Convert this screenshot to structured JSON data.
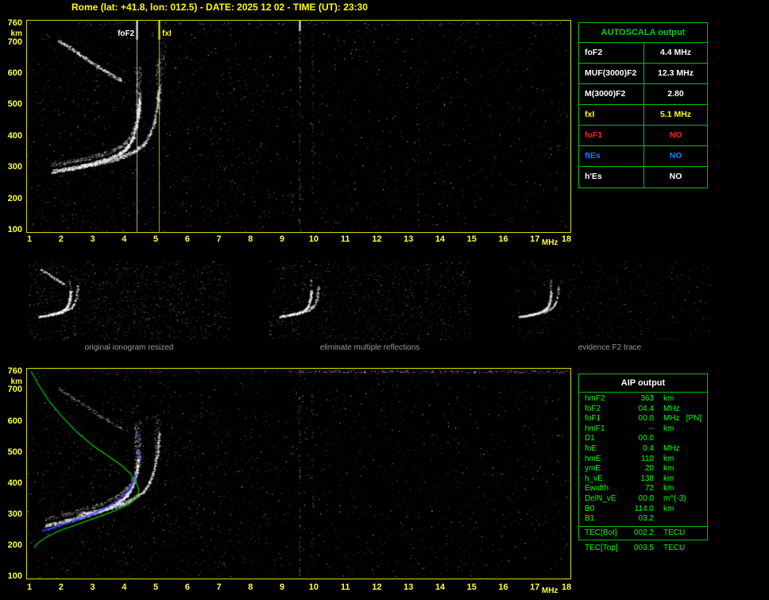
{
  "header": {
    "title": "Rome (lat: +41.8, lon: 012.5) - DATE: 2025 12 02 - TIME (UT): 23:30"
  },
  "colors": {
    "background": "#000000",
    "title": "#ffff00",
    "axis_labels": "#ffff42",
    "plot_border": "#d8d800",
    "table_border": "#00c000",
    "aip_text": "#00ff00",
    "caption": "#9a9a9a",
    "foF2_marker": "#ffffff",
    "fxI_marker": "#ffff00"
  },
  "top_plot": {
    "y_unit": "km",
    "x_unit": "MHz",
    "y_ticks": [
      760,
      700,
      600,
      500,
      400,
      300,
      200,
      100
    ],
    "x_ticks": [
      1,
      2,
      3,
      4,
      5,
      6,
      7,
      8,
      9,
      10,
      11,
      12,
      13,
      14,
      15,
      16,
      17,
      18
    ]
  },
  "bottom_plot": {
    "y_unit": "km",
    "x_unit": "MHz",
    "y_ticks": [
      760,
      700,
      600,
      500,
      400,
      300,
      200,
      100
    ],
    "x_ticks": [
      1,
      2,
      3,
      4,
      5,
      6,
      7,
      8,
      9,
      10,
      11,
      12,
      13,
      14,
      15,
      16,
      17,
      18
    ]
  },
  "autoscala_table": {
    "title": "AUTOSCALA output",
    "rows": [
      {
        "param": "foF2",
        "value": "4.4 MHz",
        "color": "#ffffff"
      },
      {
        "param": "MUF(3000)F2",
        "value": "12.3 MHz",
        "color": "#ffffff"
      },
      {
        "param": "M(3000)F2",
        "value": "2.80",
        "color": "#ffffff"
      },
      {
        "param": "fxI",
        "value": "5.1 MHz",
        "color": "#ffff00"
      },
      {
        "param": "foF1",
        "value": "NO",
        "color": "#ff2020"
      },
      {
        "param": "ftEs",
        "value": "NO",
        "color": "#0080ff"
      },
      {
        "param": "h'Es",
        "value": "NO",
        "color": "#ffffff"
      }
    ]
  },
  "thumbnails": {
    "items": [
      {
        "caption": "original ionogram resized"
      },
      {
        "caption": "eliminate multiple reflections"
      },
      {
        "caption": "evidence F2 trace"
      }
    ]
  },
  "aip_table": {
    "title": "AIP output",
    "rows": [
      {
        "param": "hmF2",
        "value": "363",
        "unit": "km"
      },
      {
        "param": "foF2",
        "value": "04.4",
        "unit": "MHz"
      },
      {
        "param": "foF1",
        "value": "00.0",
        "unit": "MHz",
        "note": "[PN]"
      },
      {
        "param": "hmF1",
        "value": "--",
        "unit": "km"
      },
      {
        "param": "D1",
        "value": "00.0",
        "unit": ""
      },
      {
        "param": "foE",
        "value": "0.4",
        "unit": "MHz"
      },
      {
        "param": "hmE",
        "value": "110",
        "unit": "km"
      },
      {
        "param": "ymE",
        "value": "20",
        "unit": "km"
      },
      {
        "param": "h_vE",
        "value": "138",
        "unit": "km"
      },
      {
        "param": "Ewidth",
        "value": "72",
        "unit": "km"
      },
      {
        "param": "DelN_vE",
        "value": "00.0",
        "unit": "m^(-3)"
      },
      {
        "param": "B0",
        "value": "114.0",
        "unit": "km"
      },
      {
        "param": "B1",
        "value": "03.2",
        "unit": ""
      }
    ],
    "tec_rows": [
      {
        "param": "TEC[Bot]",
        "value": "002.2",
        "unit": "TECU"
      },
      {
        "param": "TEC[Top]",
        "value": "003.5",
        "unit": "TECU"
      }
    ]
  },
  "chart_data": [
    {
      "type": "scatter",
      "title": "Autoscala scaled ionogram",
      "xlabel": "MHz",
      "ylabel": "km",
      "xlim": [
        1,
        18
      ],
      "ylim": [
        100,
        760
      ],
      "grid": false,
      "series": [
        {
          "name": "F2 ordinary trace",
          "x": [
            1.7,
            2.0,
            2.3,
            2.6,
            2.9,
            3.2,
            3.5,
            3.8,
            4.0,
            4.15,
            4.3,
            4.4,
            4.45,
            4.48
          ],
          "y": [
            285,
            291,
            296,
            302,
            309,
            317,
            326,
            339,
            353,
            370,
            400,
            441,
            479,
            515
          ]
        },
        {
          "name": "F2 extraordinary trace",
          "x": [
            2.5,
            2.9,
            3.3,
            3.7,
            4.0,
            4.3,
            4.6,
            4.8,
            4.95,
            5.05,
            5.1
          ],
          "y": [
            299,
            306,
            314,
            324,
            335,
            350,
            372,
            402,
            445,
            505,
            560
          ]
        },
        {
          "name": "second reflection trace",
          "x": [
            1.9,
            2.15,
            2.4,
            2.65,
            2.9,
            3.15,
            3.4,
            3.65,
            3.9
          ],
          "y": [
            705,
            690,
            673,
            656,
            639,
            622,
            606,
            591,
            577
          ]
        }
      ],
      "vlines": [
        {
          "label": "foF2",
          "x": 4.4,
          "color": "#ffffff"
        },
        {
          "label": "fxI",
          "x": 5.1,
          "color": "#ffff00"
        }
      ]
    },
    {
      "type": "scatter",
      "title": "AIP ionogram with restored trace and electron density profile",
      "xlabel": "MHz",
      "ylabel": "km",
      "xlim": [
        1,
        18
      ],
      "ylim": [
        100,
        760
      ],
      "grid": false,
      "series": [
        {
          "name": "F2 ordinary trace",
          "x": [
            1.5,
            1.9,
            2.3,
            2.7,
            3.1,
            3.5,
            3.8,
            4.0,
            4.15,
            4.3,
            4.4,
            4.45
          ],
          "y": [
            262,
            272,
            282,
            293,
            306,
            321,
            336,
            352,
            370,
            400,
            440,
            483
          ]
        },
        {
          "name": "F2 extraordinary trace",
          "x": [
            2.5,
            2.9,
            3.3,
            3.7,
            4.0,
            4.3,
            4.6,
            4.8,
            4.95,
            5.05,
            5.1
          ],
          "y": [
            299,
            306,
            314,
            324,
            335,
            350,
            372,
            402,
            445,
            505,
            560
          ]
        },
        {
          "name": "restored trace",
          "color": "#4444ff",
          "x": [
            1.4,
            1.8,
            2.2,
            2.6,
            3.0,
            3.4,
            3.8,
            4.1,
            4.3,
            4.4
          ],
          "y": [
            246,
            258,
            271,
            285,
            301,
            320,
            345,
            372,
            405,
            432
          ]
        },
        {
          "name": "electron density profile",
          "color": "#00b400",
          "x": [
            1.05,
            1.3,
            1.6,
            2.0,
            2.5,
            3.0,
            3.5,
            3.9,
            4.2,
            4.38,
            4.46,
            4.42,
            4.15,
            3.7,
            3.1,
            2.5,
            1.95,
            1.6,
            1.35,
            1.2,
            1.15
          ],
          "y": [
            760,
            714,
            667,
            617,
            564,
            521,
            486,
            458,
            430,
            402,
            378,
            356,
            332,
            310,
            288,
            266,
            246,
            229,
            213,
            199,
            192
          ]
        }
      ]
    }
  ]
}
